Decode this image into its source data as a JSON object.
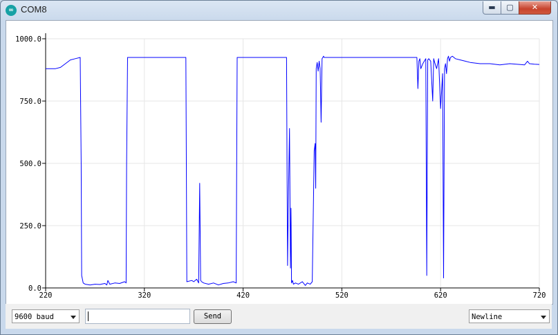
{
  "window": {
    "title": "COM8",
    "icon": "arduino-infinity-icon",
    "controls": {
      "minimize": "▬",
      "maximize": "▢",
      "close": "✕"
    }
  },
  "chart_data": {
    "type": "line",
    "title": "",
    "xlabel": "",
    "ylabel": "",
    "xlim": [
      220,
      720
    ],
    "ylim": [
      0,
      1000
    ],
    "x_ticks": [
      "220",
      "320",
      "420",
      "520",
      "620",
      "720"
    ],
    "y_ticks": [
      "0.0",
      "250.0",
      "500.0",
      "750.0",
      "1000.0"
    ],
    "x_tick_values": [
      220,
      320,
      420,
      520,
      620,
      720
    ],
    "y_tick_values": [
      0,
      250,
      500,
      750,
      1000
    ],
    "grid": true,
    "line_color": "#0000ff",
    "series": [
      {
        "x": [
          220,
          230,
          235,
          240,
          245,
          250,
          255,
          256,
          256.5,
          258,
          260,
          265,
          270,
          275,
          280,
          282,
          283,
          285,
          290,
          295,
          300,
          301.5,
          302,
          303,
          310,
          320,
          330,
          340,
          350,
          360,
          362,
          362.5,
          363,
          368,
          370,
          373,
          375,
          376,
          377,
          378,
          380,
          385,
          390,
          395,
          400,
          405,
          410,
          413,
          413.5,
          414,
          420,
          430,
          440,
          450,
          460,
          464,
          464.5,
          465,
          466,
          467,
          468,
          468.5,
          469,
          470,
          471,
          473,
          476,
          480,
          483,
          485,
          488,
          490,
          492,
          493,
          493.5,
          494,
          495,
          496,
          497,
          498,
          499,
          500,
          501,
          501.5,
          502,
          503,
          504,
          510,
          520,
          540,
          560,
          580,
          590,
          596,
          597,
          598,
          599,
          600,
          602,
          605,
          606,
          607,
          608,
          610,
          612,
          613,
          614,
          616,
          618,
          620,
          622,
          623,
          624,
          625,
          626,
          627,
          628,
          629,
          630,
          632,
          635,
          640,
          645,
          650,
          660,
          670,
          680,
          690,
          700,
          705,
          708,
          710,
          715,
          720
        ],
        "y": [
          880,
          880,
          885,
          900,
          915,
          920,
          925,
          500,
          50,
          20,
          15,
          12,
          15,
          14,
          18,
          12,
          30,
          15,
          20,
          18,
          25,
          20,
          500,
          925,
          925,
          925,
          925,
          925,
          925,
          925,
          925,
          500,
          25,
          30,
          25,
          35,
          20,
          420,
          30,
          25,
          20,
          15,
          20,
          12,
          18,
          20,
          25,
          20,
          500,
          925,
          925,
          925,
          925,
          925,
          925,
          925,
          500,
          90,
          400,
          640,
          80,
          320,
          20,
          30,
          15,
          20,
          15,
          25,
          10,
          20,
          15,
          25,
          550,
          580,
          400,
          880,
          905,
          870,
          910,
          880,
          665,
          920,
          927,
          930,
          925,
          925,
          925,
          925,
          925,
          925,
          925,
          925,
          925,
          925,
          800,
          910,
          920,
          880,
          900,
          920,
          50,
          915,
          920,
          910,
          750,
          920,
          905,
          880,
          920,
          720,
          860,
          40,
          880,
          900,
          860,
          920,
          930,
          910,
          925,
          930,
          920,
          915,
          910,
          905,
          900,
          900,
          895,
          900,
          897,
          895,
          910,
          900,
          898,
          897
        ]
      }
    ]
  },
  "bottom": {
    "baud_select": "9600 baud",
    "input_value": "",
    "send_label": "Send",
    "line_ending_select": "Newline"
  }
}
